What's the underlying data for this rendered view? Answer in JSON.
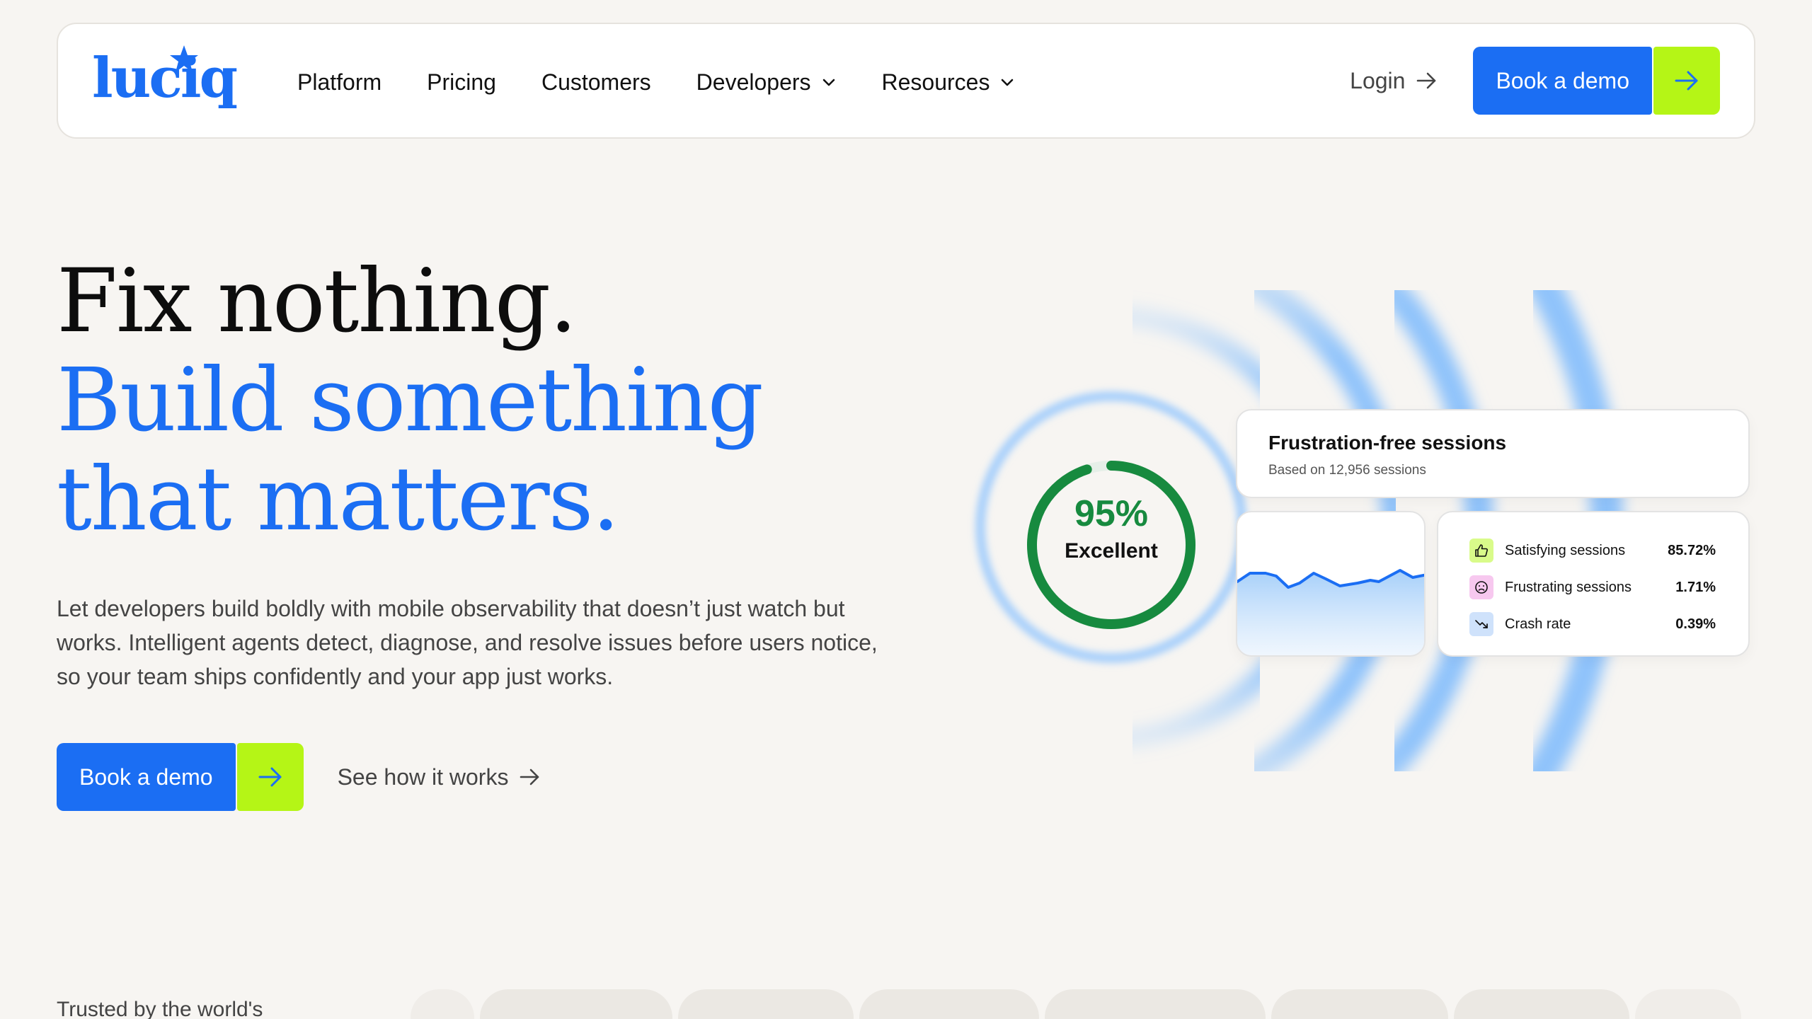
{
  "brand": {
    "name": "luciq",
    "primary": "#1b6ef3",
    "accent": "#b5f516"
  },
  "nav": {
    "links": [
      {
        "label": "Platform",
        "dropdown": false
      },
      {
        "label": "Pricing",
        "dropdown": false
      },
      {
        "label": "Customers",
        "dropdown": false
      },
      {
        "label": "Developers",
        "dropdown": true
      },
      {
        "label": "Resources",
        "dropdown": true
      }
    ],
    "login_label": "Login",
    "cta_label": "Book a demo"
  },
  "hero": {
    "title_line1": "Fix nothing.",
    "title_line2": "Build something",
    "title_line3": "that matters.",
    "subtitle": "Let developers build boldly with mobile observability that doesn’t just watch but works. Intelligent agents detect, diagnose, and resolve issues before users notice, so your team ships confidently and your app just works.",
    "cta_label": "Book a demo",
    "secondary_label": "See how it works"
  },
  "visual": {
    "score_percent": "95%",
    "score_value": 0.95,
    "score_label": "Excellent",
    "card_title": "Frustration-free sessions",
    "card_subtitle": "Based on 12,956 sessions",
    "stats": [
      {
        "icon": "thumbs-up-icon",
        "label": "Satisfying sessions",
        "value": "85.72%",
        "icon_bg": "#d9fb8a"
      },
      {
        "icon": "frown-face-icon",
        "label": "Frustrating sessions",
        "value": "1.71%",
        "icon_bg": "#f7c8ef"
      },
      {
        "icon": "trend-down-icon",
        "label": "Crash rate",
        "value": "0.39%",
        "icon_bg": "#cfe2fb"
      }
    ]
  },
  "trusted": {
    "label": "Trusted by the world's"
  }
}
